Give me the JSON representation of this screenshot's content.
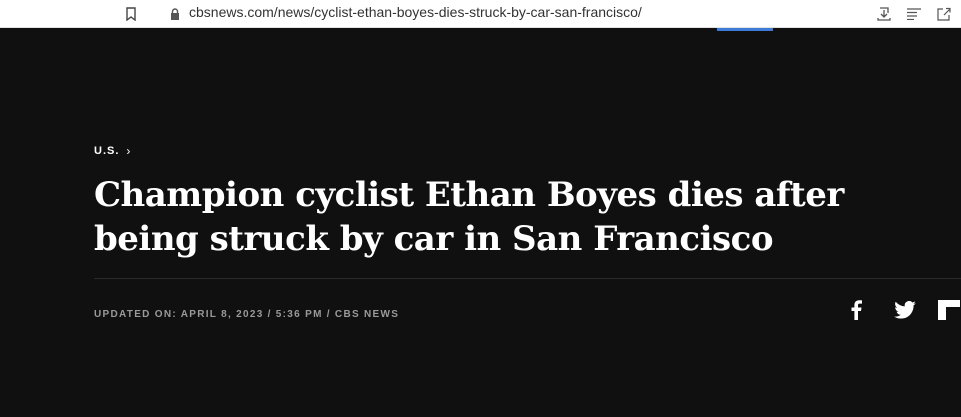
{
  "browser": {
    "url": "cbsnews.com/news/cyclist-ethan-boyes-dies-struck-by-car-san-francisco/",
    "icons": [
      "bookmark-icon",
      "lock-icon",
      "download-icon",
      "reading-list-icon",
      "share-icon"
    ]
  },
  "article": {
    "breadcrumb": {
      "section": "U.S.",
      "chevron": "›"
    },
    "headline": "Champion cyclist Ethan Boyes dies after being struck by car in San Francisco",
    "byline": "UPDATED ON: APRIL 8, 2023 / 5:36 PM / CBS NEWS",
    "social": {
      "icons": [
        "facebook-icon",
        "twitter-icon",
        "flipboard-icon"
      ]
    }
  },
  "colors": {
    "background": "#101010",
    "headline": "#ffffff",
    "byline": "#9a9a9a",
    "accent": "#3d7bd6"
  }
}
